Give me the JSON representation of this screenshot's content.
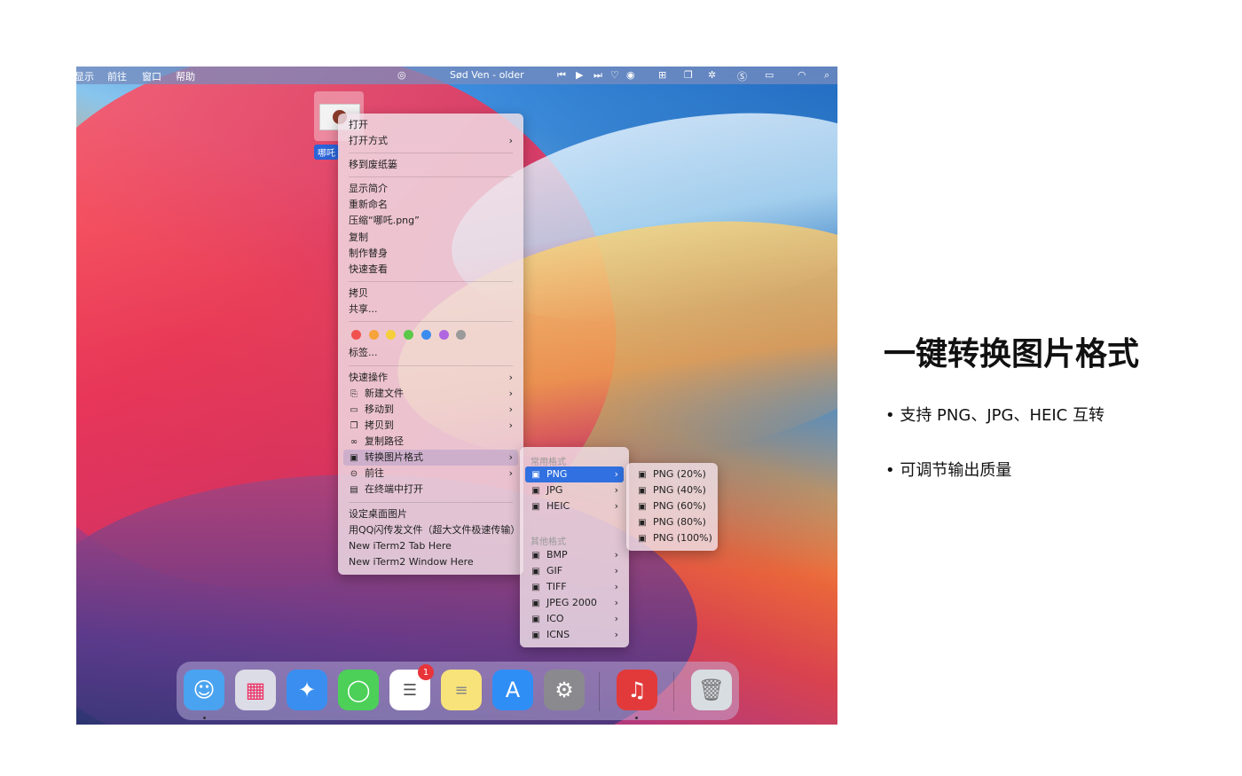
{
  "menubar": {
    "items": [
      "显示",
      "前往",
      "窗口",
      "帮助"
    ],
    "now_playing": "Sød Ven - older"
  },
  "file": {
    "label": "哪吒"
  },
  "context_menu": {
    "items": [
      {
        "label": "打开"
      },
      {
        "label": "打开方式",
        "arrow": "›"
      },
      {
        "label": "移到废纸篓"
      },
      {
        "label": "显示简介"
      },
      {
        "label": "重新命名"
      },
      {
        "label": "压缩“哪吒.png”"
      },
      {
        "label": "复制"
      },
      {
        "label": "制作替身"
      },
      {
        "label": "快速查看"
      },
      {
        "label": "拷贝"
      },
      {
        "label": "共享..."
      },
      {
        "label": "标签..."
      },
      {
        "label": "快速操作",
        "arrow": "›"
      },
      {
        "label": "新建文件",
        "arrow": "›"
      },
      {
        "label": "移动到",
        "arrow": "›"
      },
      {
        "label": "拷贝到",
        "arrow": "›"
      },
      {
        "label": "复制路径"
      },
      {
        "label": "转换图片格式",
        "arrow": "›"
      },
      {
        "label": "前往",
        "arrow": "›"
      },
      {
        "label": "在终端中打开"
      },
      {
        "label": "设定桌面图片"
      },
      {
        "label": "用QQ闪传发文件（超大文件极速传输）"
      },
      {
        "label": "New iTerm2 Tab Here"
      },
      {
        "label": "New iTerm2 Window Here"
      }
    ],
    "tag_colors": [
      "#f0524f",
      "#f5a33a",
      "#f4cf3b",
      "#5cc84a",
      "#3c8cf0",
      "#b066e0",
      "#9a9a9a"
    ]
  },
  "format_menu": {
    "common_header": "常用格式",
    "other_header": "其他格式",
    "common": [
      "PNG",
      "JPG",
      "HEIC"
    ],
    "other": [
      "BMP",
      "GIF",
      "TIFF",
      "JPEG 2000",
      "ICO",
      "ICNS"
    ],
    "arrow": "›"
  },
  "quality_menu": {
    "items": [
      "PNG (20%)",
      "PNG (40%)",
      "PNG (60%)",
      "PNG (80%)",
      "PNG (100%)"
    ]
  },
  "dock": {
    "reminders_badge": "1",
    "apps": [
      {
        "name": "Finder",
        "color": "#4aa3f0"
      },
      {
        "name": "Launchpad",
        "color": "#dcdce6"
      },
      {
        "name": "Safari",
        "color": "#3a8ef0"
      },
      {
        "name": "Messages",
        "color": "#4cd058"
      },
      {
        "name": "Reminders",
        "color": "#ffffff"
      },
      {
        "name": "Notes",
        "color": "#f8e37a"
      },
      {
        "name": "App Store",
        "color": "#2f8ef6"
      },
      {
        "name": "System Preferences",
        "color": "#8a8a8e"
      },
      {
        "name": "NetEase Music",
        "color": "#e23a3a"
      },
      {
        "name": "Trash",
        "color": "#d8dde2"
      }
    ]
  },
  "promo": {
    "headline": "一键转换图片格式",
    "bullets": [
      "• 支持 PNG、JPG、HEIC 互转",
      "• 可调节输出质量"
    ]
  }
}
